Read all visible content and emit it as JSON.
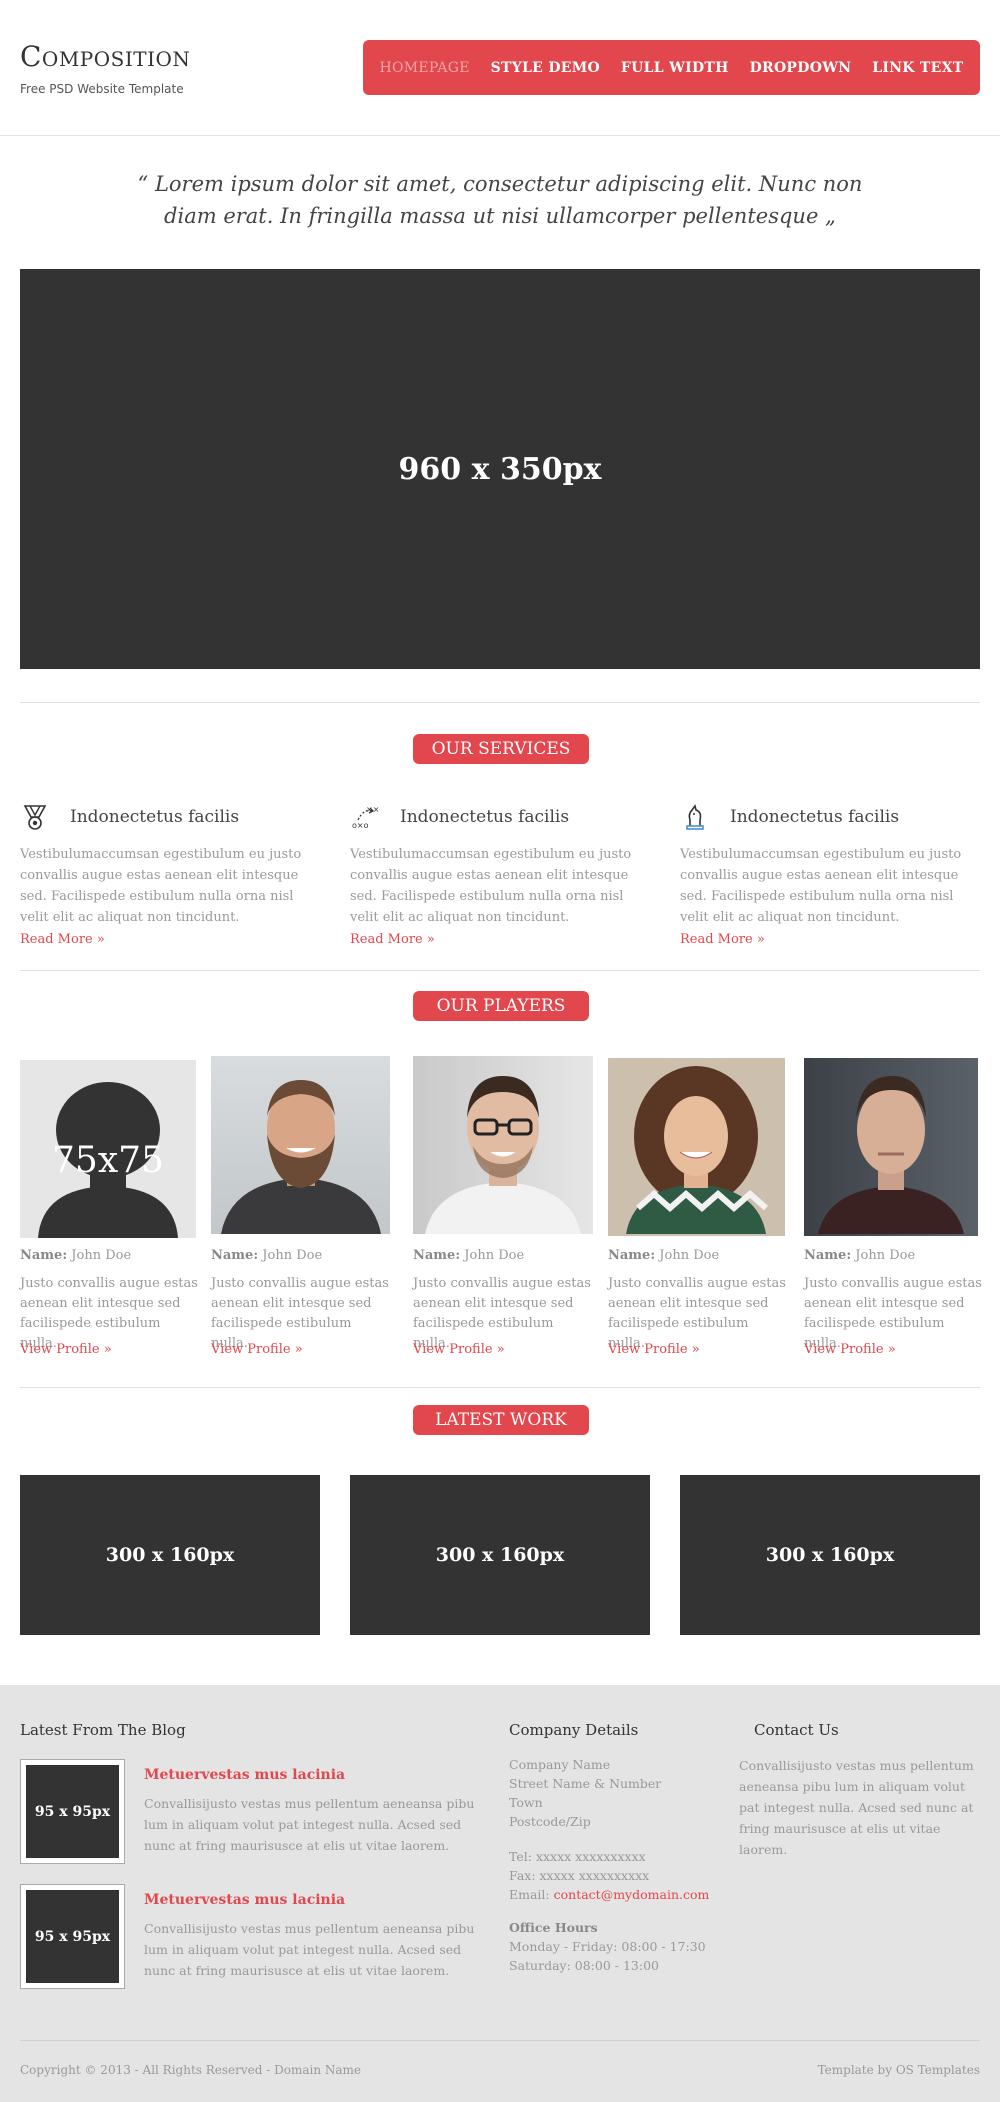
{
  "header": {
    "logo": "Composition",
    "tagline": "Free PSD Website Template",
    "nav": [
      "HOMEPAGE",
      "STYLE DEMO",
      "FULL WIDTH",
      "DROPDOWN",
      "LINK TEXT"
    ]
  },
  "quote": "“ Lorem ipsum dolor sit amet, consectetur adipiscing elit. Nunc non diam erat. In fringilla massa ut nisi ullamcorper pellentesque „",
  "hero": {
    "label": "960 x 350px"
  },
  "services": {
    "heading": "OUR SERVICES",
    "items": [
      {
        "title": "Indonectetus facilis",
        "text": "Vestibulumaccumsan egestibulum eu justo convallis augue estas aenean elit intesque sed. Facilispede estibulum nulla orna nisl velit elit ac aliquat non tincidunt.",
        "link": "Read More »",
        "icon": "medal-icon"
      },
      {
        "title": "Indonectetus facilis",
        "text": "Vestibulumaccumsan egestibulum eu justo convallis augue estas aenean elit intesque sed. Facilispede estibulum nulla orna nisl velit elit ac aliquat non tincidunt.",
        "link": "Read More »",
        "icon": "strategy-icon"
      },
      {
        "title": "Indonectetus facilis",
        "text": "Vestibulumaccumsan egestibulum eu justo convallis augue estas aenean elit intesque sed. Facilispede estibulum nulla orna nisl velit elit ac aliquat non tincidunt.",
        "link": "Read More »",
        "icon": "chess-knight-icon"
      }
    ]
  },
  "players": {
    "heading": "OUR PLAYERS",
    "placeholder_label": "75x75",
    "name_label": "Name:",
    "items": [
      {
        "name": "John Doe",
        "text": "Justo convallis augue estas aenean elit intesque sed facilispede estibulum nulla.",
        "link": "View Profile »"
      },
      {
        "name": "John Doe",
        "text": "Justo convallis augue estas aenean elit intesque sed facilispede estibulum nulla.",
        "link": "View Profile »"
      },
      {
        "name": "John Doe",
        "text": "Justo convallis augue estas aenean elit intesque sed facilispede estibulum nulla.",
        "link": "View Profile »"
      },
      {
        "name": "John Doe",
        "text": "Justo convallis augue estas aenean elit intesque sed facilispede estibulum nulla.",
        "link": "View Profile »"
      },
      {
        "name": "John Doe",
        "text": "Justo convallis augue estas aenean elit intesque sed facilispede estibulum nulla.",
        "link": "View Profile »"
      }
    ]
  },
  "work": {
    "heading": "LATEST WORK",
    "items": [
      "300 x 160px",
      "300 x 160px",
      "300 x 160px"
    ]
  },
  "footer": {
    "blog": {
      "heading": "Latest From The Blog",
      "posts": [
        {
          "thumb": "95 x 95px",
          "title": "Metuervestas mus lacinia",
          "text": "Convallisijusto vestas mus pellentum aeneansa pibu lum in aliquam volut pat integest nulla. Acsed sed nunc at fring maurisusce at elis ut vitae laorem."
        },
        {
          "thumb": "95 x 95px",
          "title": "Metuervestas mus lacinia",
          "text": "Convallisijusto vestas mus pellentum aeneansa pibu lum in aliquam volut pat integest nulla. Acsed sed nunc at fring maurisusce at elis ut vitae laorem."
        }
      ]
    },
    "company": {
      "heading": "Company Details",
      "address": [
        "Company Name",
        "Street Name & Number",
        "Town",
        "Postcode/Zip"
      ],
      "tel": "Tel: xxxxx xxxxxxxxxx",
      "fax": "Fax: xxxxx xxxxxxxxxx",
      "email_label": "Email:",
      "email": "contact@mydomain.com",
      "hours_heading": "Office Hours",
      "hours": [
        "Monday - Friday: 08:00 - 17:30",
        "Saturday: 08:00 - 13:00"
      ]
    },
    "contact": {
      "heading": "Contact Us",
      "text": "Convallisijusto vestas mus pellentum aeneansa pibu lum in aliquam volut pat integest nulla. Acsed sed nunc at fring maurisusce at elis ut vitae laorem."
    },
    "copyright": "Copyright © 2013 - All Rights Reserved - Domain Name",
    "credit": "Template by OS Templates"
  },
  "colors": {
    "accent": "#e2474d",
    "dark_placeholder": "#333333",
    "footer_bg": "#e4e4e4"
  }
}
